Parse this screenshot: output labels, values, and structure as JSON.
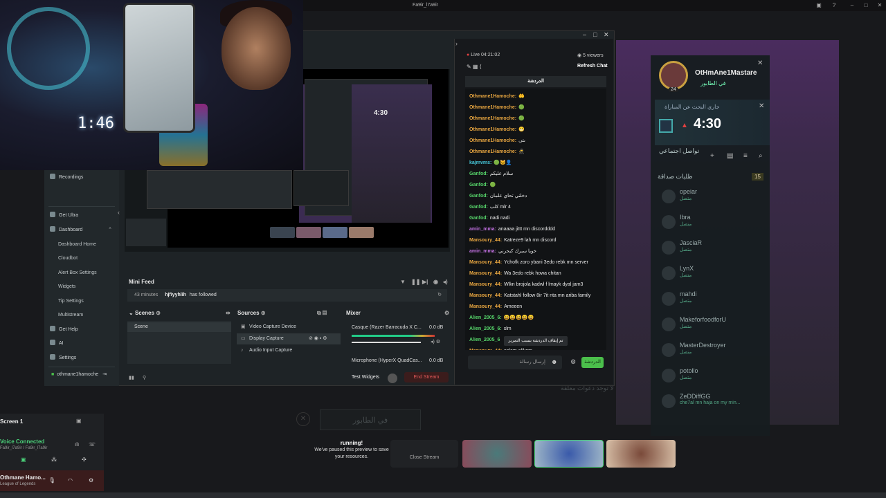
{
  "window": {
    "title": "Fa9ir_l7a9ir"
  },
  "webcam": {
    "clock": "1:46"
  },
  "sidebar": {
    "items": [
      {
        "label": "Recordings",
        "icon": "record-icon"
      },
      {
        "label": "Get Ultra",
        "icon": "ultra-icon"
      },
      {
        "label": "Dashboard",
        "icon": "dashboard-icon"
      },
      {
        "label": "Dashboard Home"
      },
      {
        "label": "Cloudbot"
      },
      {
        "label": "Alert Box Settings"
      },
      {
        "label": "Widgets"
      },
      {
        "label": "Tip Settings"
      },
      {
        "label": "Multistream"
      },
      {
        "label": "Get Help",
        "icon": "help-icon"
      },
      {
        "label": "AI",
        "icon": "ai-icon"
      },
      {
        "label": "Settings",
        "icon": "gear-icon"
      }
    ],
    "user": "othmane1hamoche"
  },
  "preview": {
    "nested_timer": "4:30"
  },
  "minifeed": {
    "title": "Mini Feed",
    "event": {
      "time": "43 minutes",
      "user": "hjfiyyhlih",
      "action": "has followed"
    }
  },
  "scenes": {
    "title": "Scenes",
    "items": [
      "Scene"
    ]
  },
  "sources": {
    "title": "Sources",
    "items": [
      "Video Capture Device",
      "Display Capture",
      "Audio Input Capture"
    ]
  },
  "mixer": {
    "title": "Mixer",
    "channels": [
      {
        "name": "Casque (Razer Barracuda X C...",
        "db": "0.0 dB"
      },
      {
        "name": "Microphone (HyperX QuadCas...",
        "db": "0.0 dB"
      }
    ]
  },
  "bottom": {
    "test_widgets": "Test Widgets",
    "end_stream": "End Stream"
  },
  "chat": {
    "live": "Live 04:21:02",
    "viewers": "5 viewers",
    "refresh": "Refresh Chat",
    "tab": "الدردشة",
    "notice": "تم إيقاف الدردشة بسبب التمرير",
    "input_placeholder": "إرسال رسالة",
    "send": "الدردشة",
    "messages": [
      {
        "user": "Othmane1Hamoche:",
        "text": "🤲",
        "color": "#e8a640"
      },
      {
        "user": "Othmane1Hamoche:",
        "text": "🟢",
        "color": "#e8a640"
      },
      {
        "user": "Othmane1Hamoche:",
        "text": "🟢",
        "color": "#e8a640"
      },
      {
        "user": "Othmane1Hamoche:",
        "text": "😬",
        "color": "#e8a640"
      },
      {
        "user": "Othmane1Hamoche:",
        "text": "ىتى",
        "color": "#e8a640"
      },
      {
        "user": "Othmane1Hamoche:",
        "text": "🥷",
        "color": "#e8a640"
      },
      {
        "user": "kajmvms:",
        "text": "🟢🐱👤",
        "color": "#46c6d8"
      },
      {
        "user": "Ganfod:",
        "text": "سلام عليكم",
        "color": "#56d46a"
      },
      {
        "user": "Ganfod:",
        "text": "🟢",
        "color": "#56d46a"
      },
      {
        "user": "Ganfod:",
        "text": "دخلني تحاي علمان",
        "color": "#56d46a"
      },
      {
        "user": "Ganfod:",
        "text": "كلب mlr 4",
        "color": "#56d46a"
      },
      {
        "user": "Ganfod:",
        "text": "nadi nadi",
        "color": "#56d46a"
      },
      {
        "user": "amin_mma:",
        "text": "anaaaa jittt mn discordddd",
        "color": "#c070e0"
      },
      {
        "user": "Mansoury_44:",
        "text": "Katreze9 lah mn discord",
        "color": "#e8a640"
      },
      {
        "user": "amin_mma:",
        "text": "خويا سبرك كبحرني",
        "color": "#c070e0"
      },
      {
        "user": "Mansoury_44:",
        "text": "Ychofk zoro ybani 3edo rebk mn server",
        "color": "#e8a640"
      },
      {
        "user": "Mansoury_44:",
        "text": "Wa 3edo rebk howa chitan",
        "color": "#e8a640"
      },
      {
        "user": "Mansoury_44:",
        "text": "Wlkn brojola kadwl f lmayk dyal jam3",
        "color": "#e8a640"
      },
      {
        "user": "Mansoury_44:",
        "text": "Katstahl follow 8ir 7it nta mn ariba family",
        "color": "#e8a640"
      },
      {
        "user": "Mansoury_44:",
        "text": "Ameeen",
        "color": "#e8a640"
      },
      {
        "user": "Alien_2005_6:",
        "text": "😄😄😄😄😄",
        "color": "#56d46a"
      },
      {
        "user": "Alien_2005_6:",
        "text": "slm",
        "color": "#56d46a"
      },
      {
        "user": "Alien_2005_6",
        "text": "",
        "color": "#56d46a"
      },
      {
        "user": "Mansoury_44:",
        "text": "salam alikom",
        "color": "#e8a640"
      }
    ]
  },
  "league": {
    "name": "OtHmAne1Mastare",
    "status": "في الطابور",
    "level": "24",
    "queue_text": "جاري البحث عن المباراة",
    "timer": "4:30",
    "social": "تواصل اجتماعي",
    "friends_title": "طلبات صداقة",
    "friends_count": "15",
    "friends": [
      {
        "name": "opeiar",
        "status": "متصل"
      },
      {
        "name": "Ibra",
        "status": "متصل"
      },
      {
        "name": "JasciaR",
        "status": "متصل"
      },
      {
        "name": "LynX",
        "status": "متصل"
      },
      {
        "name": "mahdi",
        "status": "متصل"
      },
      {
        "name": "MakeforfoodforU",
        "status": "متصل"
      },
      {
        "name": "MasterDestroyer",
        "status": "متصل"
      },
      {
        "name": "potollo",
        "status": "متصل"
      },
      {
        "name": "ZeDDiffGG",
        "status": "che7al mn haja on my min..."
      }
    ],
    "no_invites": "لا توجد دعوات معلقة",
    "queue_button": "في الطابور"
  },
  "discord": {
    "screen": "Screen 1",
    "voice": "Voice Connected",
    "channel": "Fa9ir_l7a9ir / Fa9ir_l7a9ir",
    "user": "Othmane Hamo...",
    "game": "League of Legends",
    "paused_title": "running!",
    "paused_text": "We've paused this preview to save your resources.",
    "close_stream": "Close Stream"
  }
}
